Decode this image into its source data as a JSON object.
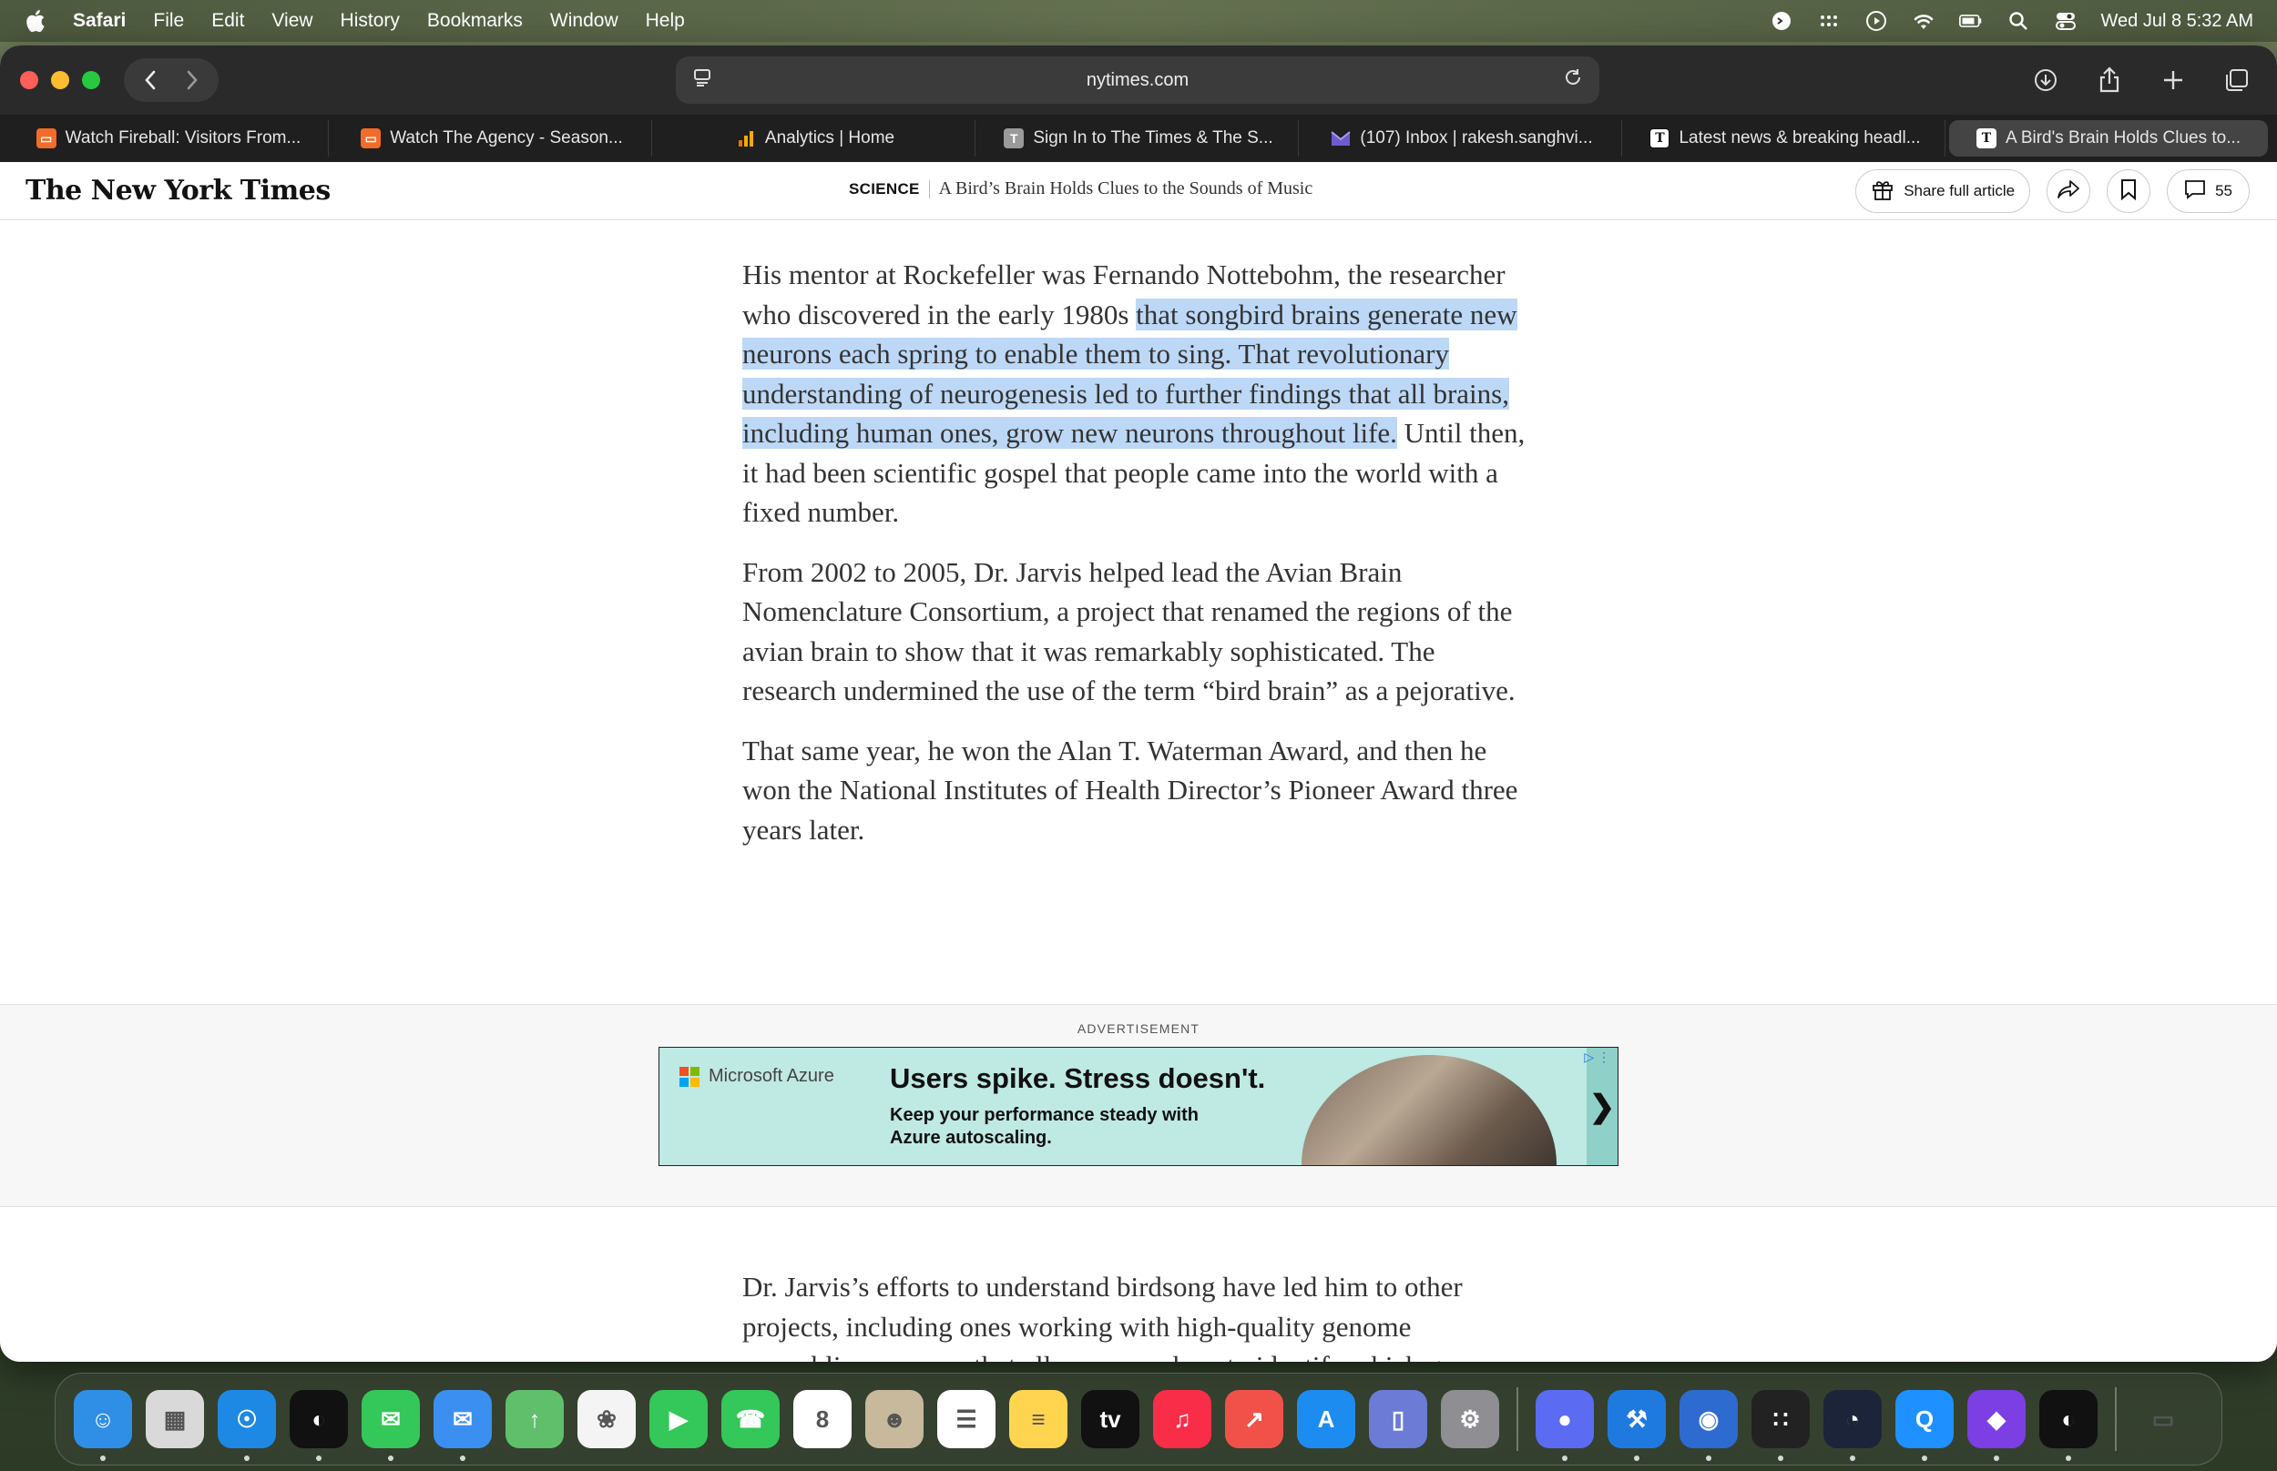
{
  "menubar": {
    "app_name": "Safari",
    "items": [
      "File",
      "Edit",
      "View",
      "History",
      "Bookmarks",
      "Window",
      "Help"
    ],
    "clock": "Wed Jul 8  5:32 AM"
  },
  "browser": {
    "url": "nytimes.com",
    "tabs": [
      {
        "label": "Watch Fireball: Visitors From...",
        "icon": "orange-tv-icon"
      },
      {
        "label": "Watch The Agency - Season...",
        "icon": "orange-tv-icon"
      },
      {
        "label": "Analytics | Home",
        "icon": "analytics-icon"
      },
      {
        "label": "Sign In to The Times & The S...",
        "icon": "t-icon"
      },
      {
        "label": "(107) Inbox | rakesh.sanghvi...",
        "icon": "mail-icon"
      },
      {
        "label": "Latest news & breaking headl...",
        "icon": "t-icon"
      },
      {
        "label": "A Bird's Brain Holds Clues to...",
        "icon": "nyt-icon",
        "active": true
      }
    ]
  },
  "nyt": {
    "logo": "The New York Times",
    "section": "SCIENCE",
    "header_title": "A Bird’s Brain Holds Clues to the Sounds of Music",
    "share_label": "Share full article",
    "comments_count": "55"
  },
  "article": {
    "p1_before": "His mentor at Rockefeller was Fernando Nottebohm, the researcher who discovered in the early 1980s ",
    "p1_highlight": "that songbird brains generate new neurons each spring to enable them to sing. That revolutionary understanding of neurogenesis led to further findings that all brains, including human ones, grow new neurons throughout life.",
    "p1_after": " Until then, it had been scientific gospel that people came into the world with a fixed number.",
    "p2": "From 2002 to 2005, Dr. Jarvis helped lead the Avian Brain Nomenclature Consortium, a project that renamed the regions of the avian brain to show that it was remarkably sophisticated. The research undermined the use of the term “bird brain” as a pejorative.",
    "p3": "That same year, he won the Alan T. Waterman Award, and then he won the National Institutes of Health Director’s Pioneer Award three years later.",
    "p4": "Dr. Jarvis’s efforts to understand birdsong have led him to other projects, including ones working with high-quality genome assemblies — maps that allow researchers to identify which genes are related to different traits. Because of that, he was appointed as"
  },
  "ad": {
    "label": "ADVERTISEMENT",
    "brand": "Microsoft Azure",
    "headline": "Users spike. Stress doesn't.",
    "subline": "Keep your performance steady with Azure autoscaling.",
    "arrow": "❯"
  },
  "dock": {
    "apps": [
      {
        "name": "finder-icon",
        "color": "#2f8fe6",
        "glyph": "☺"
      },
      {
        "name": "launchpad-icon",
        "color": "#d9d9d9",
        "glyph": "▦"
      },
      {
        "name": "safari-icon",
        "color": "#1e88e5",
        "glyph": "☉"
      },
      {
        "name": "podcast-app-icon",
        "color": "#111111",
        "glyph": "◐"
      },
      {
        "name": "messages-icon",
        "color": "#34c759",
        "glyph": "✉"
      },
      {
        "name": "mail-icon",
        "color": "#3b8ff0",
        "glyph": "✉"
      },
      {
        "name": "maps-icon",
        "color": "#5fbf6b",
        "glyph": "↑"
      },
      {
        "name": "photos-icon",
        "color": "#f4f4f4",
        "glyph": "❀"
      },
      {
        "name": "facetime-icon",
        "color": "#34c759",
        "glyph": "▶"
      },
      {
        "name": "phone-icon",
        "color": "#34c759",
        "glyph": "☎"
      },
      {
        "name": "calendar-icon",
        "color": "#ffffff",
        "glyph": "8"
      },
      {
        "name": "contacts-icon",
        "color": "#c8b89c",
        "glyph": "☻"
      },
      {
        "name": "reminders-icon",
        "color": "#ffffff",
        "glyph": "☰"
      },
      {
        "name": "notes-icon",
        "color": "#ffd54f",
        "glyph": "≡"
      },
      {
        "name": "apple-tv-icon",
        "color": "#111111",
        "glyph": "tv"
      },
      {
        "name": "music-icon",
        "color": "#fa2d48",
        "glyph": "♫"
      },
      {
        "name": "rocket-app-icon",
        "color": "#f0524a",
        "glyph": "↗"
      },
      {
        "name": "app-store-icon",
        "color": "#1d8cf0",
        "glyph": "A"
      },
      {
        "name": "simulator-icon",
        "color": "#6b7bd6",
        "glyph": "▯"
      },
      {
        "name": "system-settings-icon",
        "color": "#8e8e93",
        "glyph": "⚙"
      },
      {
        "name": "separator"
      },
      {
        "name": "chat-app-icon",
        "color": "#5b6cf2",
        "glyph": "●"
      },
      {
        "name": "xcode-icon",
        "color": "#1f7ae0",
        "glyph": "⚒"
      },
      {
        "name": "database-app-icon",
        "color": "#2d6bd1",
        "glyph": "◉"
      },
      {
        "name": "grid-app-icon",
        "color": "#222222",
        "glyph": "∷"
      },
      {
        "name": "speedtest-icon",
        "color": "#1b2438",
        "glyph": "◔"
      },
      {
        "name": "q-app-icon",
        "color": "#1e90ff",
        "glyph": "Q"
      },
      {
        "name": "github-desktop-icon",
        "color": "#7b3fe4",
        "glyph": "◆"
      },
      {
        "name": "podcast-app-2-icon",
        "color": "#111111",
        "glyph": "◐"
      },
      {
        "name": "separator"
      },
      {
        "name": "trash-icon",
        "color": "transparent",
        "glyph": "▭"
      }
    ]
  },
  "colors": {
    "highlight": "#bcd8f6",
    "ad_bg": "#bfe9e3",
    "close": "#fe5f57",
    "minimize": "#febc2e",
    "zoom": "#28c840"
  }
}
